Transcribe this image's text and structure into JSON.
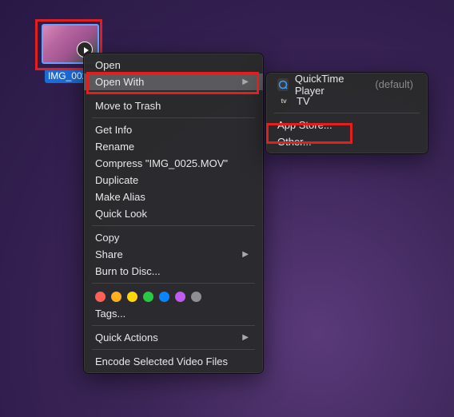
{
  "file": {
    "label": "IMG_0025"
  },
  "menu": {
    "open": "Open",
    "open_with": "Open With",
    "move_to_trash": "Move to Trash",
    "get_info": "Get Info",
    "rename": "Rename",
    "compress": "Compress \"IMG_0025.MOV\"",
    "duplicate": "Duplicate",
    "make_alias": "Make Alias",
    "quick_look": "Quick Look",
    "copy": "Copy",
    "share": "Share",
    "burn_to_disc": "Burn to Disc...",
    "tags": "Tags...",
    "quick_actions": "Quick Actions",
    "encode": "Encode Selected Video Files"
  },
  "submenu": {
    "quicktime": "QuickTime Player",
    "quicktime_default": "(default)",
    "tv": "TV",
    "app_store": "App Store...",
    "other": "Other..."
  },
  "tag_colors": [
    "red",
    "orange",
    "yellow",
    "green",
    "blue",
    "purple",
    "gray"
  ]
}
